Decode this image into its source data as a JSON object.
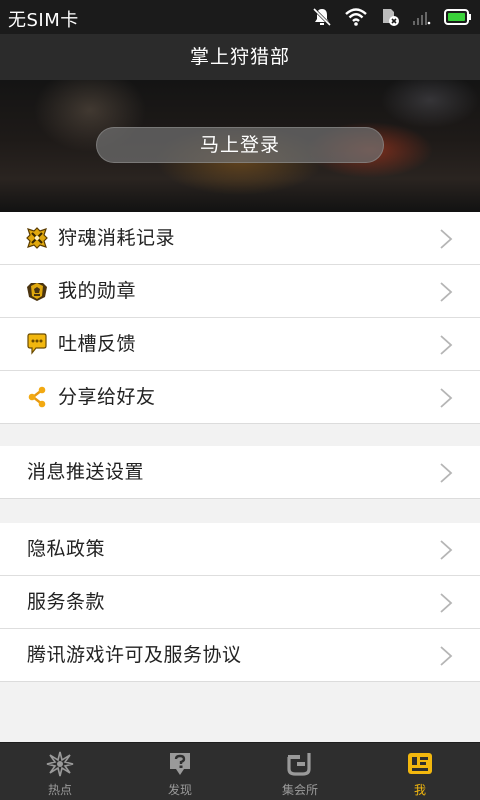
{
  "status_bar": {
    "carrier": "无SIM卡"
  },
  "header": {
    "title": "掌上狩猎部"
  },
  "banner": {
    "login_label": "马上登录"
  },
  "menu_group_1": [
    {
      "label": "狩魂消耗记录",
      "icon": "hunter-soul-icon"
    },
    {
      "label": "我的勋章",
      "icon": "medal-icon"
    },
    {
      "label": "吐槽反馈",
      "icon": "feedback-icon"
    },
    {
      "label": "分享给好友",
      "icon": "share-icon"
    }
  ],
  "menu_group_2": [
    {
      "label": "消息推送设置"
    }
  ],
  "menu_group_3": [
    {
      "label": "隐私政策"
    },
    {
      "label": "服务条款"
    },
    {
      "label": "腾讯游戏许可及服务协议"
    }
  ],
  "bottom_nav": [
    {
      "label": "热点",
      "icon": "hotspot-icon",
      "active": false
    },
    {
      "label": "发现",
      "icon": "discover-icon",
      "active": false
    },
    {
      "label": "集会所",
      "icon": "gathering-hall-icon",
      "active": false
    },
    {
      "label": "我",
      "icon": "me-icon",
      "active": true
    }
  ],
  "colors": {
    "accent": "#f2b70e",
    "title_bar": "#2b2b2b",
    "status_bar": "#1b1b1b"
  }
}
